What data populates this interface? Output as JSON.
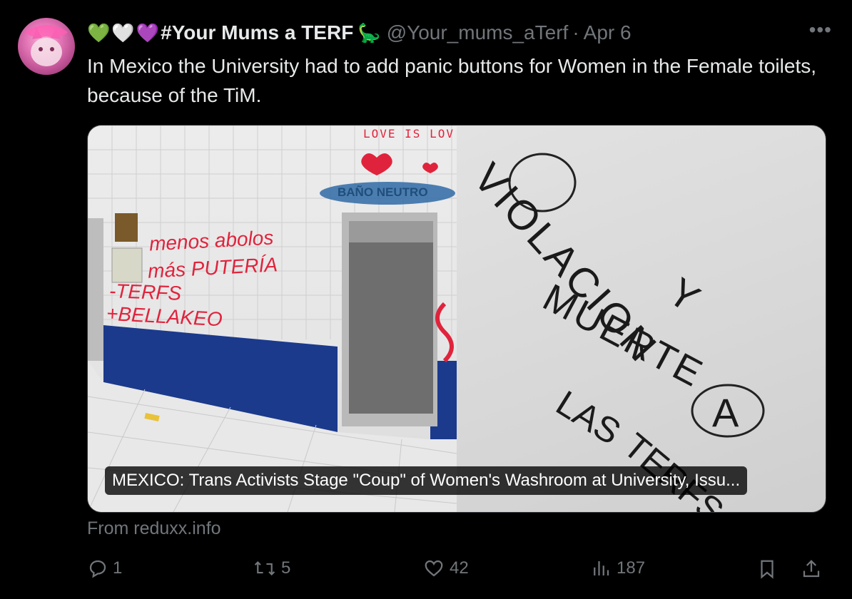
{
  "tweet": {
    "emoji_hearts": [
      "💚",
      "🤍",
      "💜"
    ],
    "author_name": "#Your Mums a TERF",
    "author_emoji": "🦕",
    "handle": "@Your_mums_aTerf",
    "separator": "·",
    "date": "Apr 6",
    "more_label": "•••",
    "text": "In Mexico the University had to add panic buttons for Women in the Female toilets, because of the TiM.",
    "card": {
      "caption": "MEXICO: Trans Activists Stage \"Coup\" of Women's Washroom at University, Issu...",
      "source": "From reduxx.info",
      "left_graffiti": [
        "LOVE IS LOV",
        "menos abolos",
        "más PUTERÍA",
        "-TERFS",
        "+BELLAKEO",
        "BAÑO NEUTRO"
      ],
      "right_graffiti": [
        "VIOLACION",
        "Y",
        "MUERTE",
        "A",
        "LAS",
        "TERFS"
      ]
    },
    "actions": {
      "replies": "1",
      "reposts": "5",
      "likes": "42",
      "views": "187"
    },
    "colors": {
      "background": "#000000",
      "text": "#e7e9ea",
      "muted": "#71767b",
      "graffiti_red": "#e0233c",
      "tile_blue": "#1b3a8c"
    }
  }
}
